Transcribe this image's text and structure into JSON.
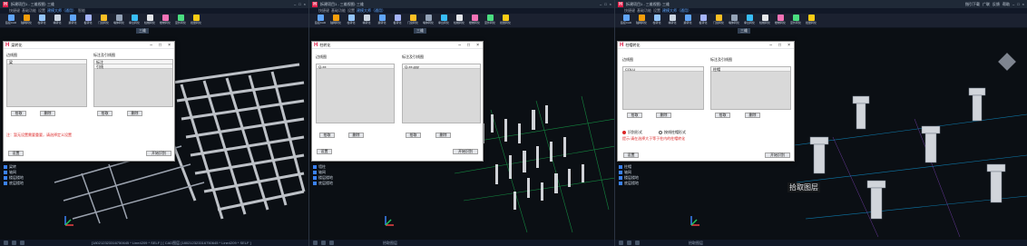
{
  "windows": [
    {
      "title": "拆建项目1 - 三维视图: 三维",
      "tabs": [
        "快捷键",
        "基础功能",
        "设置",
        "建模大师（通用）",
        "智能"
      ],
      "dialog": {
        "title": "梁转化",
        "left_label": "边线图",
        "left_items": [
          "梁"
        ],
        "right_label": "标注及引线图",
        "right_items": [
          "标注",
          "引线"
        ],
        "btn_pick_left": "拾取",
        "btn_del_left": "删除",
        "btn_pick_right": "拾取",
        "btn_del_right": "删除",
        "note": "注：暂无设置需要重要，请选择定义设置",
        "btn_settings": "设置",
        "btn_start": "开始识别"
      },
      "viewport_tab": "三维",
      "layers": [
        "梁转",
        "轴网",
        "楼层楼地",
        "底层楼地"
      ],
      "status": "[180212323316750645 * Line4209 * SELF ] [ CAD图层 [180212323316750645 * Line4209 * SELF ]"
    },
    {
      "title": "拆建项目1 - 三维视图: 三维",
      "tabs": [
        "快捷键",
        "基础功能",
        "设置",
        "建模大师（通用）"
      ],
      "dialog": {
        "title": "柱转化",
        "left_label": "边线图",
        "left_items": [
          "Q-xx"
        ],
        "right_label": "标注及引线图",
        "right_items": [
          "Q-xx-yyy"
        ],
        "btn_pick_left": "拾取",
        "btn_del_left": "删除",
        "btn_pick_right": "拾取",
        "btn_del_right": "删除",
        "btn_settings": "设置",
        "btn_start": "开始识别"
      },
      "viewport_tab": "三维",
      "layers": [
        "墙柱",
        "轴网",
        "楼层楼地",
        "底层楼地"
      ],
      "status": "拾取图层"
    },
    {
      "title": "拆建项目1 - 三维视图: 三维",
      "tabs": [
        "快捷键",
        "基础功能",
        "设置",
        "建模大师（通用）"
      ],
      "dialog": {
        "title": "柱帽转化",
        "left_label": "边线图",
        "left_items": [
          "COLU"
        ],
        "right_label": "标注及引线图",
        "right_items": [
          "柱帽"
        ],
        "btn_pick_left": "拾取",
        "btn_del_left": "删除",
        "btn_pick_right": "拾取",
        "btn_del_right": "删除",
        "radio_a": "识别形式",
        "radio_b": "按线柱帽形式",
        "note": "提示:请在选择大于等于柱内的柱帽转化",
        "btn_settings": "设置",
        "btn_start": "开始识别"
      },
      "viewport_tab": "三维",
      "float_label": "拾取图层",
      "layers": [
        "柱帽",
        "轴网",
        "楼层楼地",
        "底层楼地"
      ],
      "status": "拾取图层"
    }
  ],
  "ribbon_items": [
    "链接CAD",
    "轴网转化",
    "柱转化",
    "墙转化",
    "梁转化",
    "板转化",
    "门窗转化",
    "墙体转化",
    "承台转化",
    "柱帽转化",
    "楼梯转化",
    "室外转化",
    "批量转化"
  ],
  "toolbar_right": [
    "指引下载",
    "广联",
    "反馈",
    "帮助"
  ],
  "colors": {
    "accent": "#2563eb",
    "brand": "#e11d48",
    "warning": "#dc2626"
  }
}
